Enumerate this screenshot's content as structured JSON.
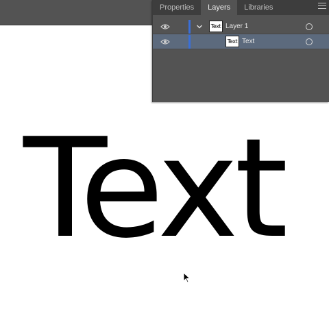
{
  "panel": {
    "tabs": [
      {
        "label": "Properties",
        "active": false
      },
      {
        "label": "Layers",
        "active": true
      },
      {
        "label": "Libraries",
        "active": false
      }
    ],
    "menu_icon": "hamburger-icon",
    "layers": [
      {
        "name": "Layer 1",
        "thumb_text": "Text",
        "expanded": true,
        "color": "#3a6fd8"
      },
      {
        "name": "Text",
        "thumb_text": "Text",
        "selected": true,
        "color": "#3a6fd8"
      }
    ]
  },
  "canvas": {
    "text": "Text"
  },
  "colors": {
    "panel_bg": "#535353",
    "tab_bar": "#3d3d3d",
    "selected_row": "#5c6a7d",
    "layer_color": "#3a6fd8"
  }
}
